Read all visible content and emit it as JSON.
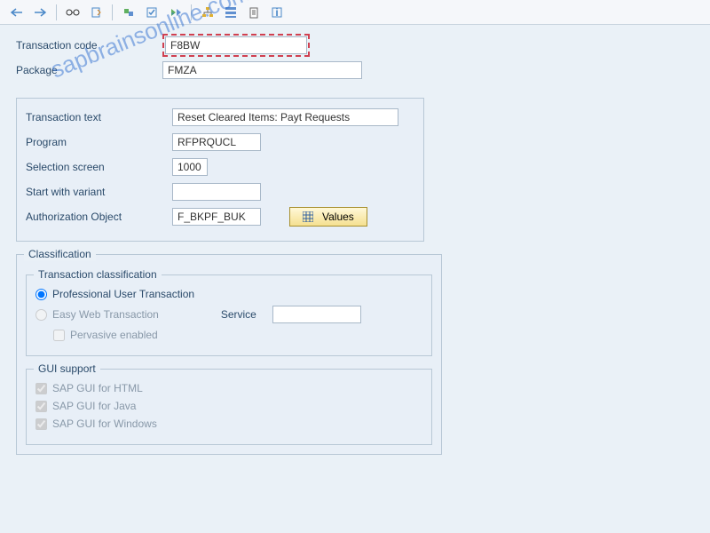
{
  "watermark": "sapbrainsonline.com",
  "header": {
    "transaction_code_label": "Transaction code",
    "transaction_code_value": "F8BW",
    "package_label": "Package",
    "package_value": "FMZA"
  },
  "details": {
    "transaction_text_label": "Transaction text",
    "transaction_text_value": "Reset Cleared Items: Payt Requests",
    "program_label": "Program",
    "program_value": "RFPRQUCL",
    "selection_screen_label": "Selection screen",
    "selection_screen_value": "1000",
    "start_variant_label": "Start with variant",
    "start_variant_value": "",
    "auth_object_label": "Authorization Object",
    "auth_object_value": "F_BKPF_BUK",
    "values_button": "Values"
  },
  "classification": {
    "title": "Classification",
    "trans_class_title": "Transaction classification",
    "radio_professional": "Professional User Transaction",
    "radio_easyweb": "Easy Web Transaction",
    "service_label": "Service",
    "service_value": "",
    "check_pervasive": "Pervasive enabled",
    "gui_support_title": "GUI support",
    "gui_html": "SAP GUI for HTML",
    "gui_java": "SAP GUI for Java",
    "gui_windows": "SAP GUI for Windows"
  }
}
